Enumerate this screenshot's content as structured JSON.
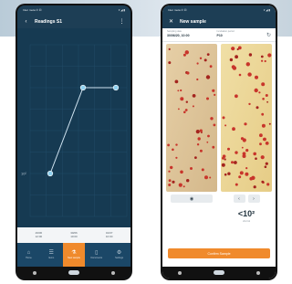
{
  "colors": {
    "header": "#1d3e55",
    "accent": "#f08a2c",
    "chart_bg": "#163a52",
    "line": "#cfe3f0",
    "point": "#8fd1f0"
  },
  "left": {
    "statusbar": {
      "left": "Inter meta ∅ ☒",
      "right": "▾ ◢ ▮"
    },
    "appbar": {
      "back_icon": "back-arrow-icon",
      "title": "Readings S1",
      "menu_icon": "more-vert-icon"
    },
    "chart": {
      "y_tick": "10²"
    },
    "x_labels": [
      {
        "date": "29/06",
        "time": "12:00"
      },
      {
        "date": "30/06",
        "time": "10:00"
      },
      {
        "date": "01/07",
        "time": "10:00"
      }
    ],
    "nav": [
      {
        "icon": "home-icon",
        "label": "Home"
      },
      {
        "icon": "list-icon",
        "label": "Items"
      },
      {
        "icon": "sample-icon",
        "label": "New sample"
      },
      {
        "icon": "document-icon",
        "label": "Documents"
      },
      {
        "icon": "gear-icon",
        "label": "Settings"
      }
    ]
  },
  "right": {
    "statusbar": {
      "left": "Inter meta ∅ ☒",
      "right": "▾ ◢ ▮"
    },
    "appbar": {
      "close_icon": "close-icon",
      "title": "New sample"
    },
    "meta": [
      {
        "label": "Sampling date",
        "value": "30/06/20, 10:00"
      },
      {
        "label": "Incubation period",
        "value": "P10"
      }
    ],
    "result": {
      "value": "<10²",
      "unit": "cfu/ml"
    },
    "confirm_label": "Confirm Sample"
  },
  "chart_data": {
    "type": "line",
    "x": [
      "29/06 12:00",
      "30/06 10:00",
      "01/07 10:00"
    ],
    "series": [
      {
        "values": [
          2,
          6,
          6
        ]
      }
    ],
    "ylim": [
      0,
      8
    ],
    "y_ticks": [
      "10²"
    ],
    "grid": true
  }
}
